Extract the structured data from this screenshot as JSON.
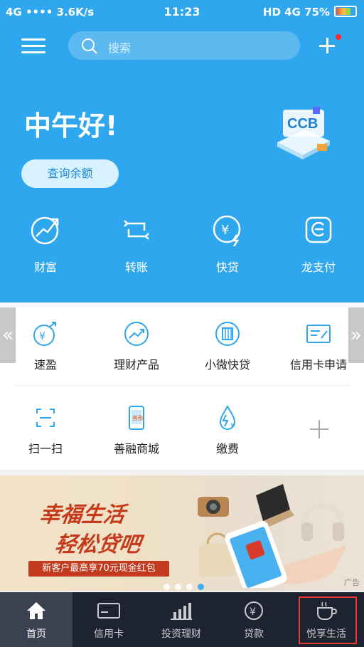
{
  "status_bar": {
    "left": "4G •••• 3.6K/s",
    "time": "11:23",
    "right": "HD 4G 75%"
  },
  "header": {
    "search_placeholder": "搜索"
  },
  "hero": {
    "greeting": "中午好!",
    "balance_button": "查询余额",
    "badge_text": "CCB"
  },
  "main_actions": [
    {
      "label": "财富",
      "icon": "wealth-icon"
    },
    {
      "label": "转账",
      "icon": "transfer-icon"
    },
    {
      "label": "快贷",
      "icon": "quick-loan-icon"
    },
    {
      "label": "龙支付",
      "icon": "long-pay-icon"
    }
  ],
  "services_row1": [
    {
      "label": "速盈",
      "icon": "yuan-growth-icon"
    },
    {
      "label": "理财产品",
      "icon": "trend-icon"
    },
    {
      "label": "小微快贷",
      "icon": "building-icon"
    },
    {
      "label": "信用卡申请",
      "icon": "card-form-icon"
    }
  ],
  "services_row2": [
    {
      "label": "扫一扫",
      "icon": "scan-icon"
    },
    {
      "label": "善融商城",
      "icon": "mall-icon"
    },
    {
      "label": "缴费",
      "icon": "payment-drop-icon"
    }
  ],
  "banner": {
    "title_line1": "幸福生活",
    "title_line2": "轻松贷吧",
    "subtitle": "新客户最高享70元现金红包",
    "ad_label": "广告",
    "slide_count": 4,
    "active_slide": 4
  },
  "tabs": [
    {
      "label": "首页",
      "icon": "home-icon"
    },
    {
      "label": "信用卡",
      "icon": "credit-card-icon"
    },
    {
      "label": "投资理财",
      "icon": "bar-chart-icon"
    },
    {
      "label": "贷款",
      "icon": "yuan-circle-icon"
    },
    {
      "label": "悦享生活",
      "icon": "coffee-cup-icon"
    }
  ],
  "colors": {
    "primary": "#2fa7ee",
    "tabbar": "#1d2330",
    "highlight": "#e53935"
  }
}
